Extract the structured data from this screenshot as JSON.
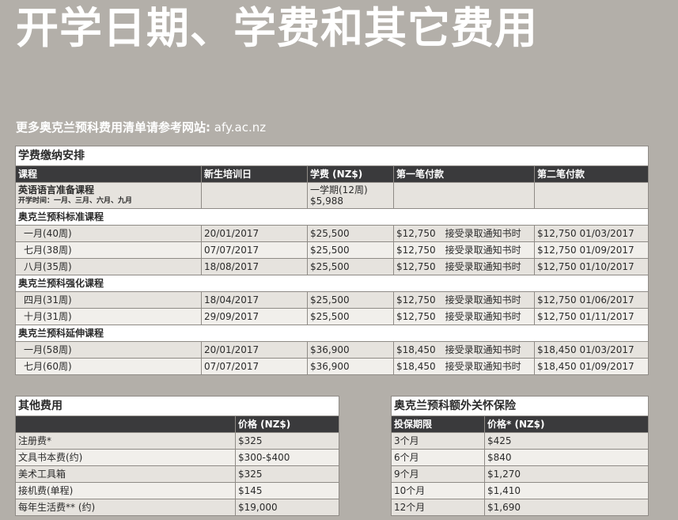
{
  "page_title": "开学日期、学费和其它费用",
  "reference": {
    "label": "更多奥克兰预科费用清单请参考网站:",
    "url": "afy.ac.nz"
  },
  "main_table": {
    "caption": "学费缴纳安排",
    "headers": [
      "课程",
      "新生培训日",
      "学费 (NZ$)",
      "第一笔付款",
      "第二笔付款"
    ],
    "language_course": {
      "name": "英语语言准备课程",
      "start_times": "开学时间：一月、三月、六月、九月",
      "fee_period": "一学期(12周)",
      "fee": "$5,988"
    },
    "groups": [
      {
        "name": "奥克兰预科标准课程",
        "rows": [
          {
            "course": "一月(40周)",
            "orientation": "20/01/2017",
            "fee": "$25,500",
            "first_amount": "$12,750",
            "first_when": "接受录取通知书时",
            "second_amount": "$12,750",
            "second_date": "01/03/2017"
          },
          {
            "course": "七月(38周)",
            "orientation": "07/07/2017",
            "fee": "$25,500",
            "first_amount": "$12,750",
            "first_when": "接受录取通知书时",
            "second_amount": "$12,750",
            "second_date": "01/09/2017"
          },
          {
            "course": "八月(35周)",
            "orientation": "18/08/2017",
            "fee": "$25,500",
            "first_amount": "$12,750",
            "first_when": "接受录取通知书时",
            "second_amount": "$12,750",
            "second_date": "01/10/2017"
          }
        ]
      },
      {
        "name": "奥克兰预科强化课程",
        "rows": [
          {
            "course": "四月(31周)",
            "orientation": "18/04/2017",
            "fee": "$25,500",
            "first_amount": "$12,750",
            "first_when": "接受录取通知书时",
            "second_amount": "$12,750",
            "second_date": "01/06/2017"
          },
          {
            "course": "十月(31周)",
            "orientation": "29/09/2017",
            "fee": "$25,500",
            "first_amount": "$12,750",
            "first_when": "接受录取通知书时",
            "second_amount": "$12,750",
            "second_date": "01/11/2017"
          }
        ]
      },
      {
        "name": "奥克兰预科延伸课程",
        "rows": [
          {
            "course": "一月(58周)",
            "orientation": "20/01/2017",
            "fee": "$36,900",
            "first_amount": "$18,450",
            "first_when": "接受录取通知书时",
            "second_amount": "$18,450",
            "second_date": "01/03/2017"
          },
          {
            "course": "七月(60周)",
            "orientation": "07/07/2017",
            "fee": "$36,900",
            "first_amount": "$18,450",
            "first_when": "接受录取通知书时",
            "second_amount": "$18,450",
            "second_date": "01/09/2017"
          }
        ]
      }
    ]
  },
  "other_fees": {
    "caption": "其他费用",
    "headers": [
      "",
      "价格 (NZ$)"
    ],
    "rows": [
      {
        "item": "注册费*",
        "price": "$325"
      },
      {
        "item": "文具书本费(约)",
        "price": "$300-$400"
      },
      {
        "item": "美术工具箱",
        "price": "$325"
      },
      {
        "item": "接机费(单程)",
        "price": "$145"
      },
      {
        "item": "每年生活费** (约)",
        "price": "$19,000"
      }
    ]
  },
  "insurance": {
    "caption": "奥克兰预科额外关怀保险",
    "headers": [
      "投保期限",
      "价格* (NZ$)"
    ],
    "rows": [
      {
        "period": "3个月",
        "price": "$425"
      },
      {
        "period": "6个月",
        "price": "$840"
      },
      {
        "period": "9个月",
        "price": "$1,270"
      },
      {
        "period": "10个月",
        "price": "$1,410"
      },
      {
        "period": "12个月",
        "price": "$1,690"
      }
    ]
  }
}
